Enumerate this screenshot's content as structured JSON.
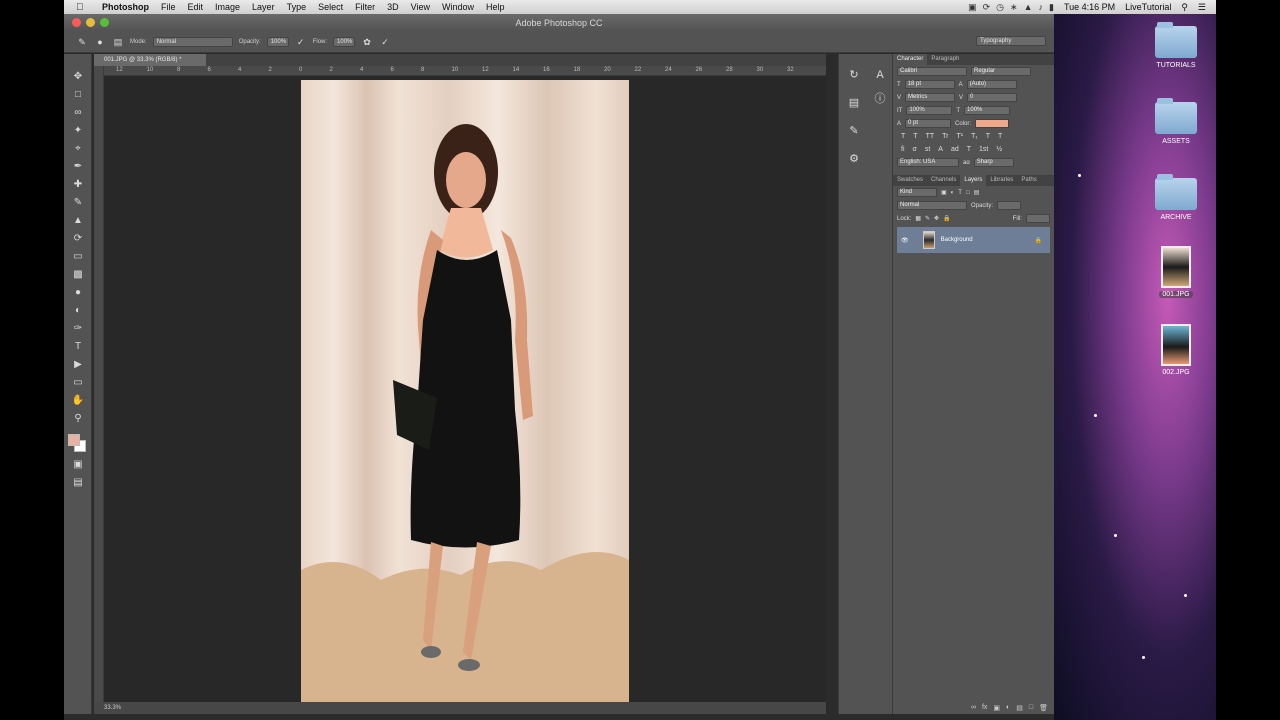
{
  "menubar": {
    "apple_icon": "apple-icon",
    "items": [
      "Photoshop",
      "File",
      "Edit",
      "Image",
      "Layer",
      "Type",
      "Select",
      "Filter",
      "3D",
      "View",
      "Window",
      "Help"
    ],
    "clock": "Tue 4:16 PM",
    "user": "LiveTutorial"
  },
  "window": {
    "title": "Adobe Photoshop CC",
    "light_colors": [
      "#fc5b57",
      "#e5bf3c",
      "#57c038"
    ]
  },
  "options_bar": {
    "mode_label": "Mode:",
    "mode_value": "Normal",
    "opacity_label": "Opacity:",
    "opacity_value": "100%",
    "flow_label": "Flow:",
    "flow_value": "100%",
    "workspace": "Typography"
  },
  "document": {
    "tab_label": "001.JPG @ 33.3% (RGB/8) *",
    "zoom": "33.3%",
    "ruler_h": [
      "12",
      "10",
      "8",
      "6",
      "4",
      "2",
      "0",
      "2",
      "4",
      "6",
      "8",
      "10",
      "12",
      "14",
      "16",
      "18",
      "20",
      "22",
      "24",
      "26",
      "28",
      "30",
      "32"
    ]
  },
  "character_panel": {
    "tabs": [
      "Character",
      "Paragraph"
    ],
    "font_family": "Calibri",
    "font_style": "Regular",
    "size": "18 pt",
    "leading": "(Auto)",
    "kerning": "Metrics",
    "tracking": "0",
    "vscale": "100%",
    "hscale": "100%",
    "baseline": "0 pt",
    "color_label": "Color:",
    "color_value": "#f0a88a",
    "glyph_row1": [
      "T",
      "T",
      "TT",
      "Tr",
      "T¹",
      "T₁",
      "T",
      "T"
    ],
    "glyph_row2": [
      "fi",
      "σ",
      "st",
      "A",
      "ad",
      "T",
      "1st",
      "½"
    ],
    "language": "English: USA",
    "aa_label": "aɑ",
    "aa_value": "Sharp"
  },
  "layers_panel": {
    "tabs": [
      "Swatches",
      "Channels",
      "Layers",
      "Libraries",
      "Paths"
    ],
    "filter_kind": "Kind",
    "blend_mode": "Normal",
    "opacity_label": "Opacity:",
    "lock_label": "Lock:",
    "fill_label": "Fill:",
    "layer_name": "Background"
  },
  "desktop": {
    "folders": [
      "TUTORIALS",
      "ASSETS",
      "ARCHIVE"
    ],
    "files": [
      "001.JPG",
      "002.JPG"
    ]
  }
}
